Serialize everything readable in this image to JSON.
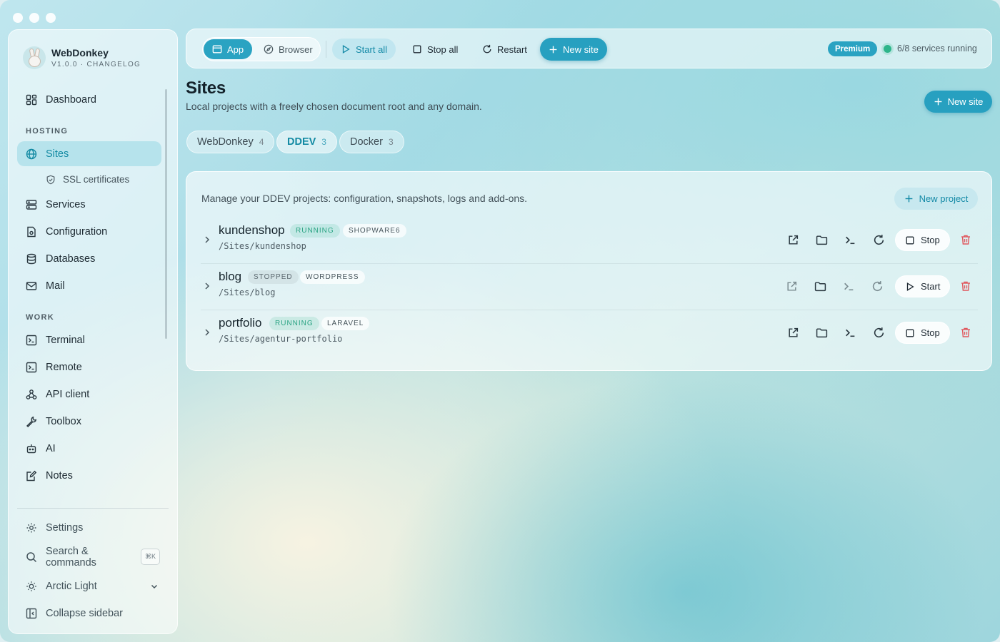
{
  "app": {
    "name": "WebDonkey",
    "version_line": "V1.0.0 · CHANGELOG"
  },
  "sidebar": {
    "dashboard": "Dashboard",
    "hosting_label": "HOSTING",
    "sites": "Sites",
    "ssl": "SSL certificates",
    "services": "Services",
    "configuration": "Configuration",
    "databases": "Databases",
    "mail": "Mail",
    "work_label": "WORK",
    "terminal": "Terminal",
    "remote": "Remote",
    "api_client": "API client",
    "toolbox": "Toolbox",
    "ai": "AI",
    "notes": "Notes",
    "settings": "Settings",
    "search": "Search & commands",
    "search_kbd": "⌘K",
    "theme": "Arctic Light",
    "collapse": "Collapse sidebar"
  },
  "toolbar": {
    "app": "App",
    "browser": "Browser",
    "start_all": "Start all",
    "stop_all": "Stop all",
    "restart": "Restart",
    "new_site": "New site",
    "premium": "Premium",
    "services_status": "6/8 services running"
  },
  "page": {
    "title": "Sites",
    "subtitle": "Local projects with a freely chosen document root and any domain.",
    "new_site": "New site"
  },
  "tabs": [
    {
      "label": "WebDonkey",
      "count": "4"
    },
    {
      "label": "DDEV",
      "count": "3"
    },
    {
      "label": "Docker",
      "count": "3"
    }
  ],
  "panel": {
    "description": "Manage your DDEV projects: configuration, snapshots, logs and add-ons.",
    "new_project": "New project",
    "projects": [
      {
        "name": "kundenshop",
        "status": "RUNNING",
        "framework": "SHOPWARE6",
        "path": "/Sites/kundenshop",
        "action": "Stop"
      },
      {
        "name": "blog",
        "status": "STOPPED",
        "framework": "WORDPRESS",
        "path": "/Sites/blog",
        "action": "Start"
      },
      {
        "name": "portfolio",
        "status": "RUNNING",
        "framework": "LARAVEL",
        "path": "/Sites/agentur-portfolio",
        "action": "Stop"
      }
    ]
  },
  "colors": {
    "accent": "#27a0c0",
    "running": "#2aa383",
    "danger": "#e0575d"
  }
}
